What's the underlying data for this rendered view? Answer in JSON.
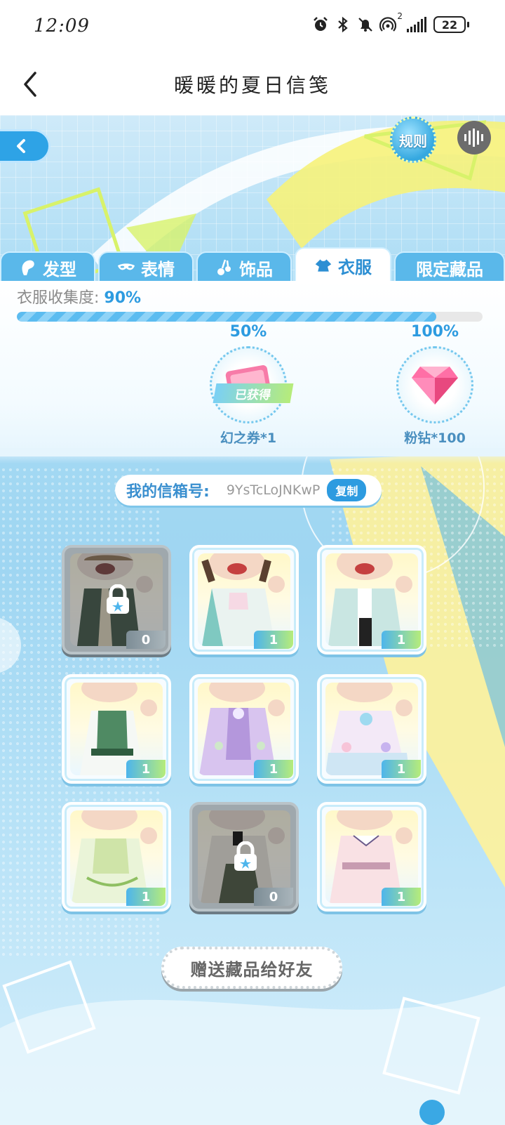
{
  "status_bar": {
    "time": "12:09",
    "battery": "22",
    "net_label": "2"
  },
  "nav": {
    "title": "暖暖的夏日信笺"
  },
  "header": {
    "rules_label": "规则"
  },
  "tabs": [
    {
      "label": "发型",
      "icon": "hair-icon",
      "active": false
    },
    {
      "label": "表情",
      "icon": "mask-icon",
      "active": false
    },
    {
      "label": "饰品",
      "icon": "accessory-icon",
      "active": false
    },
    {
      "label": "衣服",
      "icon": "clothes-icon",
      "active": true
    },
    {
      "label": "限定藏品",
      "icon": "",
      "active": false
    }
  ],
  "collection": {
    "label": "衣服收集度:",
    "value": "90%",
    "progress": 0.9,
    "milestones": [
      {
        "percent": "50%",
        "reward": "幻之券*1",
        "status": "已获得"
      },
      {
        "percent": "100%",
        "reward": "粉钻*100",
        "status": ""
      }
    ]
  },
  "mailbox": {
    "label": "我的信箱号:",
    "id": "9YsTcLoJNKwP",
    "copy_label": "复制"
  },
  "items": [
    {
      "count": "0",
      "locked": true
    },
    {
      "count": "1",
      "locked": false
    },
    {
      "count": "1",
      "locked": false
    },
    {
      "count": "1",
      "locked": false
    },
    {
      "count": "1",
      "locked": false
    },
    {
      "count": "1",
      "locked": false
    },
    {
      "count": "1",
      "locked": false
    },
    {
      "count": "0",
      "locked": true
    },
    {
      "count": "1",
      "locked": false
    }
  ],
  "gift_button": {
    "label": "赠送藏品给好友"
  },
  "colors": {
    "accent": "#2d9be0",
    "tab_bg": "#5ab8ea",
    "background": "#a8dbf4"
  }
}
